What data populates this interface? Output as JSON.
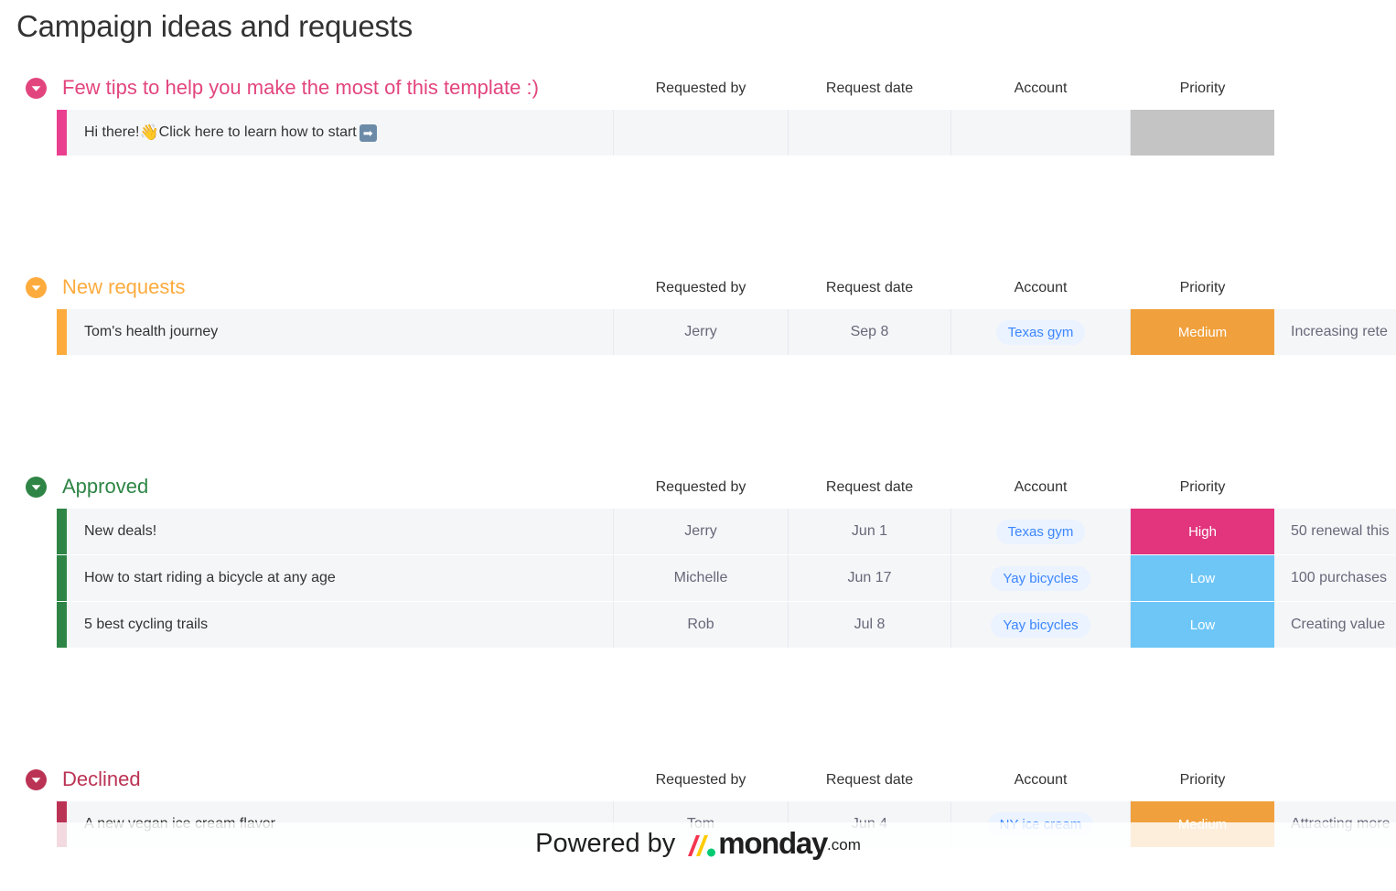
{
  "page_title": "Campaign ideas and requests",
  "columns": {
    "name": "",
    "requested_by": "Requested by",
    "request_date": "Request date",
    "account": "Account",
    "priority": "Priority"
  },
  "colors": {
    "tips_pink": "#e2457d",
    "tips_pink_bar": "#e93f8e",
    "new_requests_orange": "#fdab3d",
    "approved_green": "#2e8545",
    "declined_red": "#bb3354",
    "priority_high": "#e2357e",
    "priority_medium": "#f0a03c",
    "priority_low": "#6ec6f7",
    "priority_empty": "#c4c4c4",
    "account_pill_bg": "#eaf3ff",
    "account_pill_text": "#3d86ff",
    "row_bg": "#f5f6f8"
  },
  "groups": [
    {
      "id": "tips",
      "title": "Few tips to help you make the most of this template :)",
      "color": "#e2457d",
      "bar_color": "#e93f8e",
      "toggle_icon": "chevron-down-circle-icon",
      "rows": [
        {
          "name_prefix": "Hi there! ",
          "name_emoji": "👋",
          "name_suffix": "Click here to learn how to start ",
          "name_badge": "➡",
          "requested_by": "",
          "request_date": "",
          "account": "",
          "priority": "",
          "priority_color": "#c4c4c4",
          "notes": ""
        }
      ]
    },
    {
      "id": "new-requests",
      "title": "New requests",
      "color": "#fdab3d",
      "bar_color": "#fdab3d",
      "toggle_icon": "chevron-down-circle-icon",
      "rows": [
        {
          "name": "Tom's health journey",
          "requested_by": "Jerry",
          "request_date": "Sep 8",
          "account": "Texas gym",
          "priority": "Medium",
          "priority_color": "#f0a03c",
          "notes": "Increasing rete"
        }
      ]
    },
    {
      "id": "approved",
      "title": "Approved",
      "color": "#2e8545",
      "bar_color": "#2e8545",
      "toggle_icon": "chevron-down-circle-icon",
      "rows": [
        {
          "name": "New deals!",
          "requested_by": "Jerry",
          "request_date": "Jun 1",
          "account": "Texas gym",
          "priority": "High",
          "priority_color": "#e2357e",
          "notes": "50 renewal this"
        },
        {
          "name": "How to start riding a bicycle at any age",
          "requested_by": "Michelle",
          "request_date": "Jun 17",
          "account": "Yay bicycles",
          "priority": "Low",
          "priority_color": "#6ec6f7",
          "notes": "100 purchases"
        },
        {
          "name": "5 best cycling trails",
          "requested_by": "Rob",
          "request_date": "Jul 8",
          "account": "Yay bicycles",
          "priority": "Low",
          "priority_color": "#6ec6f7",
          "notes": "Creating value"
        }
      ]
    },
    {
      "id": "declined",
      "title": "Declined",
      "color": "#bb3354",
      "bar_color": "#bb3354",
      "toggle_icon": "chevron-down-circle-icon",
      "rows": [
        {
          "name": "A new vegan ice cream flavor",
          "requested_by": "Tom",
          "request_date": "Jun 4",
          "account": "NY ice cream",
          "priority": "Medium",
          "priority_color": "#f0a03c",
          "notes": "Attracting more"
        }
      ]
    }
  ],
  "watermark": {
    "powered_by": "Powered by",
    "brand": "monday",
    "tld": ".com",
    "logo_bar_colors": [
      "#f5354f",
      "#ffcb00",
      "#00ca72"
    ]
  }
}
